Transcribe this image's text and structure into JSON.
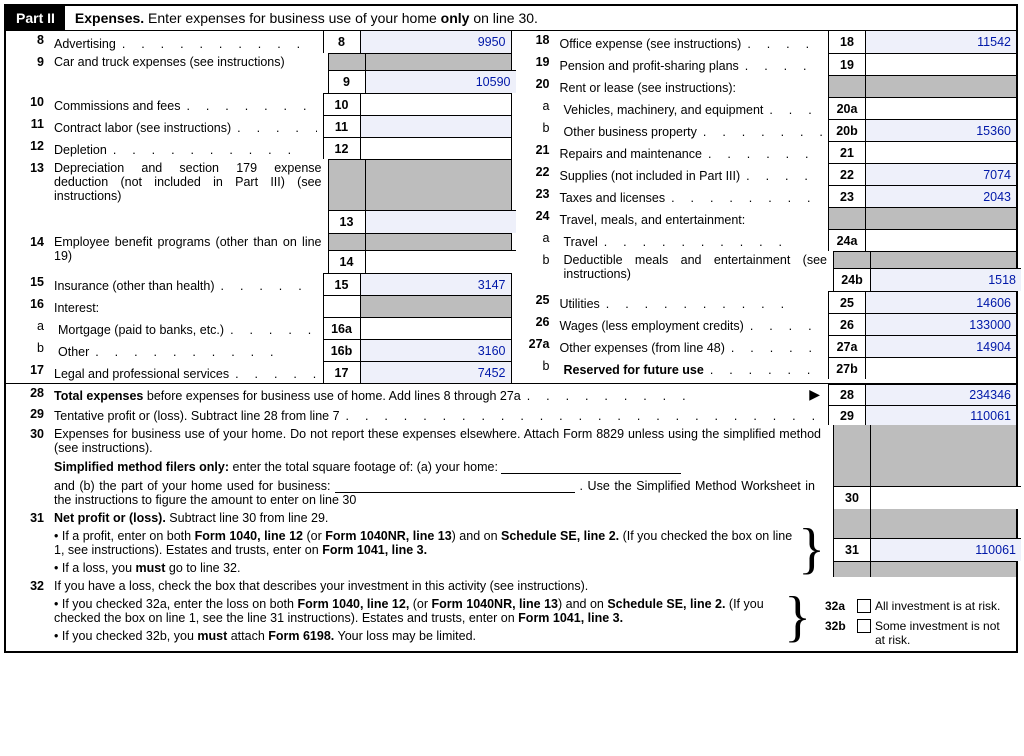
{
  "part": {
    "badge": "Part II",
    "title_prefix": "Expenses.",
    "title_rest": " Enter expenses for business use of your home ",
    "only": "only",
    "title_tail": " on line 30."
  },
  "left": [
    {
      "n": "8",
      "label": "Advertising",
      "box": "8",
      "val": "9950",
      "cls": ""
    },
    {
      "n": "9",
      "label": "Car and truck expenses (see instructions)",
      "box": "9",
      "val": "10590",
      "cls": "",
      "multi": true
    },
    {
      "n": "10",
      "label": "Commissions and fees",
      "box": "10",
      "val": "",
      "cls": "white"
    },
    {
      "n": "11",
      "label": "Contract labor (see instructions)",
      "box": "11",
      "val": "",
      "cls": ""
    },
    {
      "n": "12",
      "label": "Depletion",
      "box": "12",
      "val": "",
      "cls": "white"
    },
    {
      "n": "13",
      "label": "Depreciation and section 179 expense deduction (not included in Part III) (see instructions)",
      "box": "13",
      "val": "",
      "cls": "",
      "multi4": true
    },
    {
      "n": "14",
      "label": "Employee benefit programs (other than on line 19)",
      "box": "14",
      "val": "",
      "cls": "white",
      "multi": true
    },
    {
      "n": "15",
      "label": "Insurance (other than health)",
      "box": "15",
      "val": "3147",
      "cls": ""
    },
    {
      "n": "16",
      "label": "Interest:",
      "box": "",
      "val": "",
      "cls": "gray",
      "header": true
    },
    {
      "n": "a",
      "sub": true,
      "label": "Mortgage (paid to banks, etc.)",
      "box": "16a",
      "val": "",
      "cls": "white"
    },
    {
      "n": "b",
      "sub": true,
      "label": "Other",
      "box": "16b",
      "val": "3160",
      "cls": ""
    },
    {
      "n": "17",
      "label": "Legal and professional services",
      "box": "17",
      "val": "7452",
      "cls": ""
    }
  ],
  "right": [
    {
      "n": "18",
      "label": "Office expense (see instructions)",
      "box": "18",
      "val": "11542",
      "cls": ""
    },
    {
      "n": "19",
      "label": "Pension and profit-sharing plans",
      "box": "19",
      "val": "",
      "cls": "white"
    },
    {
      "n": "20",
      "label": "Rent or lease (see instructions):",
      "box": "",
      "val": "",
      "cls": "gray",
      "header": true,
      "graybox": true
    },
    {
      "n": "a",
      "sub": true,
      "label": "Vehicles, machinery, and equipment",
      "box": "20a",
      "val": "",
      "cls": "white"
    },
    {
      "n": "b",
      "sub": true,
      "label": "Other business property",
      "box": "20b",
      "val": "15360",
      "cls": ""
    },
    {
      "n": "21",
      "label": "Repairs and maintenance",
      "box": "21",
      "val": "",
      "cls": "white"
    },
    {
      "n": "22",
      "label": "Supplies (not included in Part III)",
      "box": "22",
      "val": "7074",
      "cls": ""
    },
    {
      "n": "23",
      "label": "Taxes and licenses",
      "box": "23",
      "val": "2043",
      "cls": ""
    },
    {
      "n": "24",
      "label": "Travel, meals, and entertainment:",
      "box": "",
      "val": "",
      "cls": "gray",
      "header": true,
      "graybox": true
    },
    {
      "n": "a",
      "sub": true,
      "label": "Travel",
      "box": "24a",
      "val": "",
      "cls": "white"
    },
    {
      "n": "b",
      "sub": true,
      "label": "Deductible meals and entertainment (see instructions)",
      "box": "24b",
      "val": "1518",
      "cls": "",
      "multi": true
    },
    {
      "n": "25",
      "label": "Utilities",
      "box": "25",
      "val": "14606",
      "cls": ""
    },
    {
      "n": "26",
      "label": "Wages (less employment credits)",
      "box": "26",
      "val": "133000",
      "cls": ""
    },
    {
      "n": "27a",
      "label": "Other expenses (from line 48)",
      "box": "27a",
      "val": "14904",
      "cls": ""
    },
    {
      "n": "b",
      "sub": true,
      "bold": true,
      "label": "Reserved for future use",
      "box": "27b",
      "val": "",
      "cls": "white"
    }
  ],
  "bottom": {
    "l28": {
      "n": "28",
      "box": "28",
      "val": "234346",
      "t1": "Total expenses",
      "t2": " before expenses for business use of home. Add lines 8 through 27a"
    },
    "l29": {
      "n": "29",
      "box": "29",
      "val": "110061",
      "t": "Tentative profit or (loss). Subtract line 28 from line 7"
    },
    "l30": {
      "n": "30",
      "box": "30",
      "val": "",
      "p1": "Expenses for business use of your home. Do not report these expenses elsewhere. Attach Form 8829 unless using the simplified method (see instructions).",
      "p2a": "Simplified method filers only:",
      "p2b": " enter the total square footage of: (a) your home:",
      "p3a": "and (b) the part of your home used for business: ",
      "p3b": ". Use the Simplified Method Worksheet in the instructions to figure the amount to enter on line 30"
    },
    "l31": {
      "n": "31",
      "box": "31",
      "val": "110061",
      "h": "Net profit or (loss).",
      "h2": "  Subtract line 30 from line 29.",
      "b1a": "If a profit, enter on both ",
      "b1b": "Form 1040, line 12",
      "b1c": " (or ",
      "b1d": "Form 1040NR, line 13",
      "b1e": ") and on ",
      "b1f": "Schedule SE, line 2.",
      "b1g": " (If you checked the box on line 1, see instructions). Estates and trusts, enter on ",
      "b1h": "Form 1041, line 3.",
      "b2a": "If a loss, you ",
      "b2b": "must",
      "b2c": "  go to line 32."
    },
    "l32": {
      "n": "32",
      "h": "If you have a loss, check the box that describes your investment in this activity (see instructions).",
      "b1a": "If you checked 32a, enter the loss on both ",
      "b1b": "Form 1040, line 12,",
      "b1c": " (or ",
      "b1d": "Form 1040NR, line 13",
      "b1e": ") and on ",
      "b1f": "Schedule SE, line 2.",
      "b1g": " (If you checked the box on line 1, see the line 31 instructions). Estates and trusts, enter on ",
      "b1h": "Form 1041, line 3.",
      "b2a": "If you checked 32b, you ",
      "b2b": "must",
      "b2c": " attach ",
      "b2d": "Form 6198.",
      "b2e": " Your loss may be limited.",
      "cb1n": "32a",
      "cb1": "All investment is at risk.",
      "cb2n": "32b",
      "cb2": "Some investment is not at risk."
    }
  }
}
